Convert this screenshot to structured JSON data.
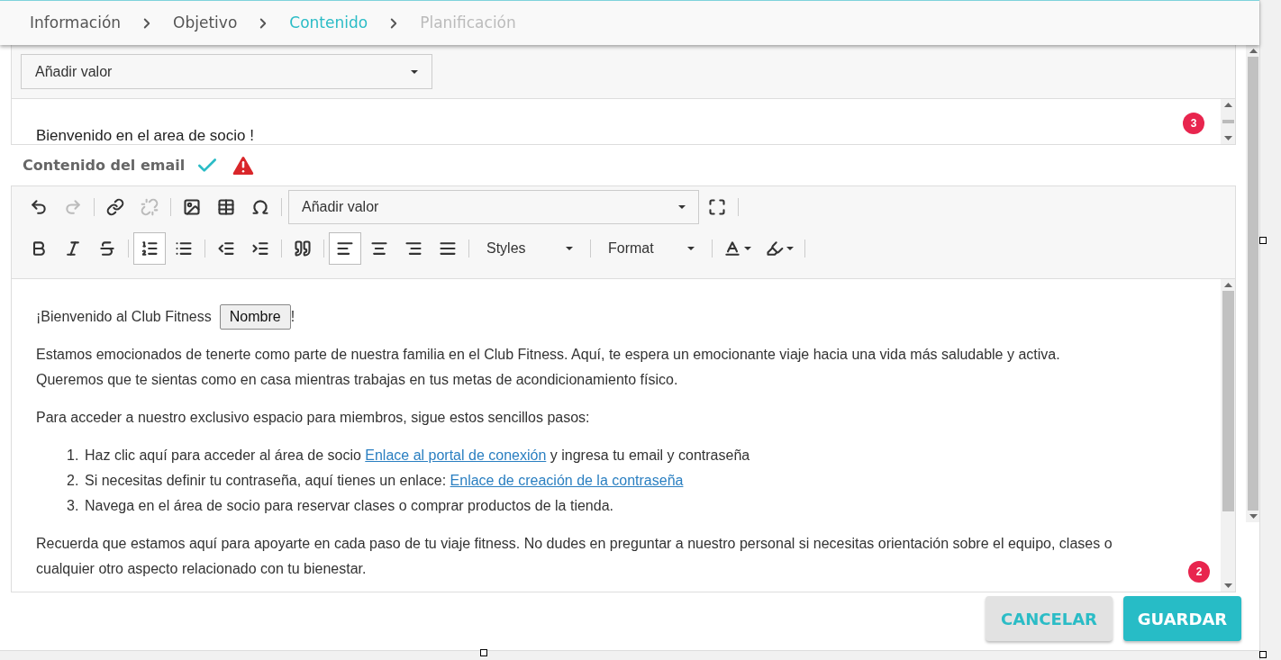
{
  "breadcrumb": [
    {
      "label": "Información",
      "selected": false,
      "disabled": false
    },
    {
      "label": "Objetivo",
      "selected": false,
      "disabled": false
    },
    {
      "label": "Contenido",
      "selected": true,
      "disabled": false
    },
    {
      "label": "Planificación",
      "selected": false,
      "disabled": true
    }
  ],
  "subject": {
    "insert_select": {
      "value": "Añadir valor"
    },
    "text": "Bienvenido en el area de socio !",
    "badge": "3"
  },
  "content_label": {
    "label": "Contenido del email",
    "valid": true,
    "warning": true
  },
  "editor": {
    "toolbar_rows": [
      [
        {
          "kind": "button",
          "active": false,
          "disabled": false
        },
        {
          "kind": "button",
          "active": false,
          "disabled": true
        },
        {
          "kind": "separator"
        },
        {
          "kind": "button",
          "active": false,
          "disabled": false
        },
        {
          "kind": "button",
          "active": false,
          "disabled": true
        },
        {
          "kind": "separator"
        },
        {
          "kind": "button",
          "active": false,
          "disabled": false
        },
        {
          "kind": "button",
          "active": false,
          "disabled": false
        },
        {
          "kind": "button",
          "active": false,
          "disabled": false
        },
        {
          "kind": "separator"
        },
        {
          "kind": "select",
          "value": "Añadir valor",
          "wide": true
        },
        {
          "kind": "button",
          "active": false,
          "disabled": false
        },
        {
          "kind": "separator"
        }
      ],
      [
        {
          "kind": "button",
          "active": false,
          "disabled": false
        },
        {
          "kind": "button",
          "active": false,
          "disabled": false
        },
        {
          "kind": "button",
          "active": false,
          "disabled": false
        },
        {
          "kind": "separator"
        },
        {
          "kind": "button",
          "active": true,
          "disabled": false
        },
        {
          "kind": "button",
          "active": false,
          "disabled": false
        },
        {
          "kind": "separator"
        },
        {
          "kind": "button",
          "active": false,
          "disabled": false
        },
        {
          "kind": "button",
          "active": false,
          "disabled": false
        },
        {
          "kind": "separator"
        },
        {
          "kind": "button",
          "active": false,
          "disabled": false
        },
        {
          "kind": "separator"
        },
        {
          "kind": "button",
          "active": true,
          "disabled": false
        },
        {
          "kind": "button",
          "active": false,
          "disabled": false
        },
        {
          "kind": "button",
          "active": false,
          "disabled": false
        },
        {
          "kind": "button",
          "active": false,
          "disabled": false
        },
        {
          "kind": "separator"
        },
        {
          "kind": "select",
          "value": "Styles",
          "wide": false
        },
        {
          "kind": "separator"
        },
        {
          "kind": "select",
          "value": "Format",
          "wide": false
        },
        {
          "kind": "separator"
        },
        {
          "kind": "menu_button",
          "active": false,
          "disabled": false
        },
        {
          "kind": "menu_button",
          "active": false,
          "disabled": false
        },
        {
          "kind": "separator"
        }
      ]
    ],
    "body": [
      {
        "kind": "greeting",
        "text": "¡Bienvenido al Club Fitness",
        "token": "Nombre",
        "after": "!"
      },
      {
        "kind": "paragraph",
        "text": "Estamos emocionados de tenerte como parte de nuestra familia en el Club Fitness. Aquí, te espera un emocionante viaje hacia una vida más saludable y activa. Queremos que te sientas como en casa mientras trabajas en tus metas de acondicionamiento físico."
      },
      {
        "kind": "paragraph",
        "text": "Para acceder a nuestro exclusivo espacio para miembros, sigue estos sencillos pasos:"
      },
      {
        "kind": "list",
        "items": [
          {
            "number": "1.",
            "segments": [
              {
                "text": "Haz clic aquí para acceder al área de socio ",
                "link": false
              },
              {
                "text": "Enlace al portal de conexión",
                "link": true
              },
              {
                "text": " y ingresa tu email y contraseña",
                "link": false
              }
            ]
          },
          {
            "number": "2.",
            "segments": [
              {
                "text": "Si necesitas definir tu contraseña, aquí tienes un enlace: ",
                "link": false
              },
              {
                "text": "Enlace de creación de la contraseña",
                "link": true
              }
            ]
          },
          {
            "number": "3.",
            "segments": [
              {
                "text": "Navega en el área de socio para reservar clases o comprar productos de la tienda.",
                "link": false
              }
            ]
          }
        ]
      },
      {
        "kind": "paragraph",
        "text": "Recuerda que estamos aquí para apoyarte en cada paso de tu viaje fitness. No dudes en preguntar a nuestro personal si necesitas orientación sobre el equipo, clases o cualquier otro aspecto relacionado con tu bienestar."
      }
    ],
    "badge": "2"
  },
  "buttons": [
    {
      "label": "CANCELAR",
      "kind": "secondary"
    },
    {
      "label": "GUARDAR",
      "kind": "primary"
    }
  ]
}
